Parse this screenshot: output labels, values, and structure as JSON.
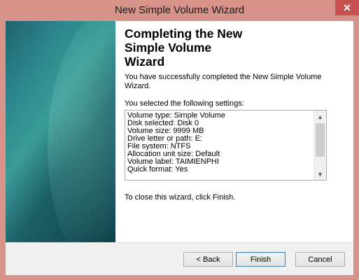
{
  "window": {
    "title": "New Simple Volume Wizard",
    "close_glyph": "✕"
  },
  "wizard": {
    "heading": "Completing the New Simple Volume Wizard",
    "success_text": "You have successfully completed the New Simple Volume Wizard.",
    "settings_label": "You selected the following settings:",
    "settings": [
      "Volume type: Simple Volume",
      "Disk selected: Disk 0",
      "Volume size: 9999 MB",
      "Drive letter or path: E:",
      "File system: NTFS",
      "Allocation unit size: Default",
      "Volume label: TAIMIENPHI",
      "Quick format: Yes"
    ],
    "close_hint": "To close this wizard, click Finish."
  },
  "scrollbar": {
    "up_glyph": "▲",
    "down_glyph": "▼"
  },
  "buttons": {
    "back": "< Back",
    "finish": "Finish",
    "cancel": "Cancel"
  },
  "colors": {
    "titlebar": "#d7928a",
    "close_button": "#c75050",
    "banner_teal": "#2d8a8e",
    "footer": "#f0f0f0"
  }
}
